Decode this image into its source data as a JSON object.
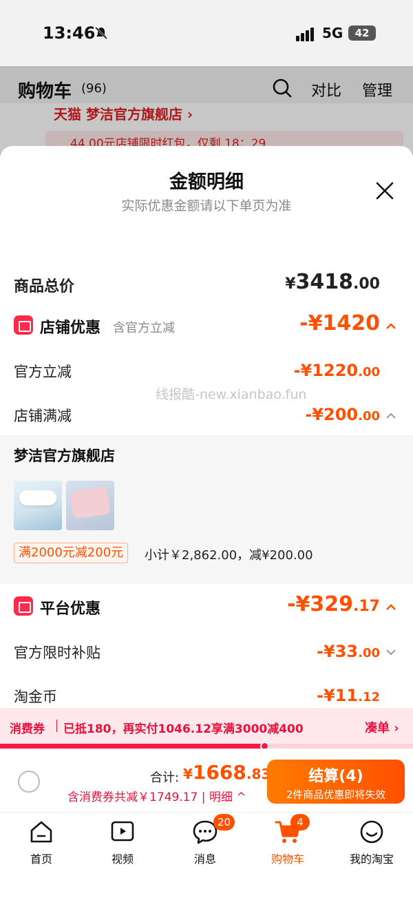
{
  "status": {
    "time": "13:46",
    "network": "5G",
    "battery": "42"
  },
  "header": {
    "title": "购物车",
    "count": "(96)",
    "compare": "对比",
    "manage": "管理"
  },
  "behind": {
    "store": "天猫 梦洁官方旗舰店 ›",
    "coupon": "44.00元店铺限时红包，仅剩 18：29"
  },
  "sheet": {
    "title": "金额明细",
    "subtitle": "实际优惠金额请以下单页为准",
    "total": {
      "label": "商品总价",
      "symbol": "¥",
      "integer": "3418",
      "decimal": ".00"
    },
    "store_discount": {
      "label": "店铺优惠",
      "note": "含官方立减",
      "amount": "-¥1420"
    },
    "official_cut": {
      "label": "官方立减",
      "amount": "-¥1220",
      "decimal": ".00"
    },
    "store_full_cut": {
      "label": "店铺满减",
      "amount": "-¥200",
      "decimal": ".00"
    },
    "store": {
      "name": "梦洁官方旗舰店",
      "tag": "满2000元减200元",
      "subtotal": "小计￥2,862.00，减¥200.00"
    },
    "platform_discount": {
      "label": "平台优惠",
      "amount": "-¥329",
      "decimal": ".17"
    },
    "subsidy": {
      "label": "官方限时补贴",
      "amount": "-¥33",
      "decimal": ".00"
    },
    "gold_coin": {
      "label": "淘金币",
      "amount": "-¥11",
      "decimal": ".12"
    },
    "watermark": "线报酷-new.xianbao.fun"
  },
  "coupon_bar": {
    "label": "消费券",
    "text": "已抵180，再实付1046.12享满3000减400",
    "action": "凑单 ›",
    "progress": 0.64
  },
  "checkout": {
    "total_label": "合计:",
    "total_symbol": "¥",
    "total_integer": "1668",
    "total_decimal": ".83",
    "discount_text": "含消费券共减￥1749.17 | 明细 ^",
    "button_label": "结算(4)",
    "button_sub": "2件商品优惠即将失效"
  },
  "tabs": [
    {
      "label": "首页",
      "icon": "home-icon"
    },
    {
      "label": "视频",
      "icon": "video-icon"
    },
    {
      "label": "消息",
      "icon": "message-icon",
      "badge": "20"
    },
    {
      "label": "购物车",
      "icon": "cart-icon",
      "badge": "4",
      "active": true
    },
    {
      "label": "我的淘宝",
      "icon": "profile-icon"
    }
  ],
  "colors": {
    "accent": "#ff5000",
    "coupon_red": "#e6113c",
    "badge_red": "#ff2a4a"
  }
}
